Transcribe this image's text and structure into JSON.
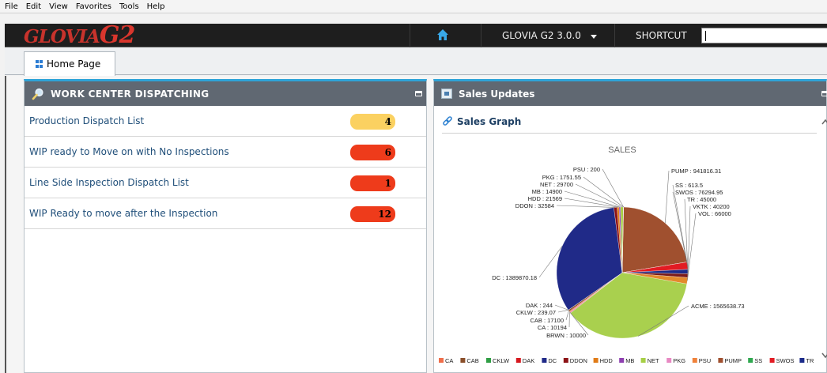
{
  "menubar": [
    "File",
    "Edit",
    "View",
    "Favorites",
    "Tools",
    "Help"
  ],
  "topbar": {
    "logo": "GLOVIA",
    "logo_suffix": "G2",
    "version": "GLOVIA G2 3.0.0",
    "shortcut": "SHORTCUT",
    "shortcut_value": ""
  },
  "tabs": [
    {
      "label": "Home Page"
    }
  ],
  "wcd": {
    "title": "WORK CENTER DISPATCHING",
    "rows": [
      {
        "label": "Production Dispatch List",
        "count": "4",
        "color": "#fbd161"
      },
      {
        "label": "WIP ready to Move on with No Inspections",
        "count": "6",
        "color": "#ee3b1b"
      },
      {
        "label": "Line Side Inspection Dispatch List",
        "count": "1",
        "color": "#ee3b1b"
      },
      {
        "label": "WIP Ready to move after the Inspection",
        "count": "12",
        "color": "#ee3b1b"
      }
    ]
  },
  "sales": {
    "title": "Sales Updates",
    "graph_title": "Sales Graph"
  },
  "chart_data": {
    "type": "pie",
    "title": "SALES",
    "slices": [
      {
        "name": "CA",
        "value": 10194,
        "color": "#ef6e4a"
      },
      {
        "name": "CAB",
        "value": 17100,
        "color": "#8a4f2b"
      },
      {
        "name": "CKLW",
        "value": 239.07,
        "color": "#2f9e44"
      },
      {
        "name": "DAK",
        "value": 244,
        "color": "#d6181e"
      },
      {
        "name": "DC",
        "value": 1389870.18,
        "color": "#202a88"
      },
      {
        "name": "DDON",
        "value": 32584,
        "color": "#8c1216"
      },
      {
        "name": "HDD",
        "value": 21569,
        "color": "#e07b17"
      },
      {
        "name": "MB",
        "value": 14900,
        "color": "#8e3fb0"
      },
      {
        "name": "NET",
        "value": 29700,
        "color": "#a6cf45"
      },
      {
        "name": "PKG",
        "value": 1751.55,
        "color": "#e889c3"
      },
      {
        "name": "PSU",
        "value": 200,
        "color": "#f0823b"
      },
      {
        "name": "PUMP",
        "value": 941816.31,
        "color": "#a0502f"
      },
      {
        "name": "SS",
        "value": 613.5,
        "color": "#2fa84f"
      },
      {
        "name": "SWOS",
        "value": 76294.95,
        "color": "#e21b23"
      },
      {
        "name": "TR",
        "value": 45000,
        "color": "#1b2b8a"
      },
      {
        "name": "VKTK",
        "value": 40200,
        "color": "#7a1b1b"
      },
      {
        "name": "VOL",
        "value": 66000,
        "color": "#e38a2c"
      },
      {
        "name": "ACME",
        "value": 1565638.73,
        "color": "#a9d04e"
      },
      {
        "name": "BRWN",
        "value": 10000,
        "color": "#e87aa8"
      }
    ],
    "legend_order": [
      "CA",
      "CAB",
      "CKLW",
      "DAK",
      "DC",
      "DDON",
      "HDD",
      "MB",
      "NET",
      "PKG",
      "PSU",
      "PUMP",
      "SS",
      "SWOS",
      "TR"
    ],
    "legend_position": "bottom"
  }
}
